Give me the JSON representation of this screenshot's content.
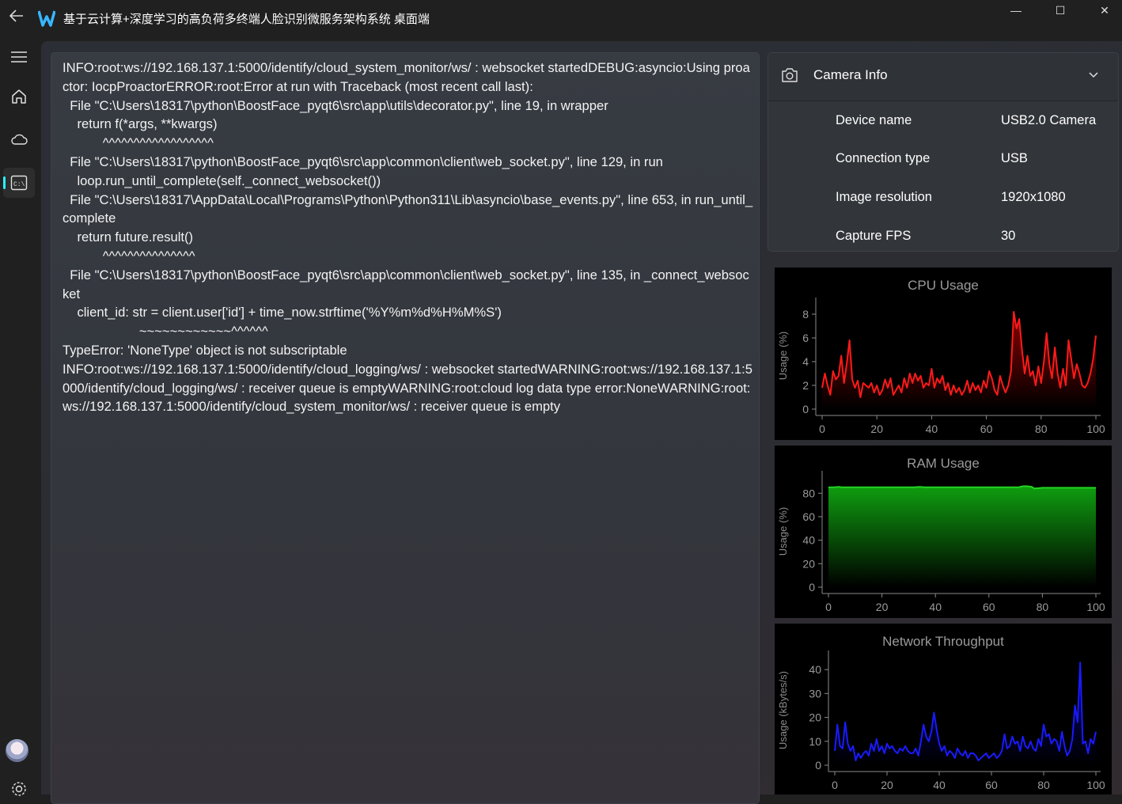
{
  "window": {
    "title": "基于云计算+深度学习的高负荷多终端人脸识别微服务架构系统 桌面端",
    "controls": {
      "minimize": "—",
      "maximize": "☐",
      "close": "✕"
    }
  },
  "sidebar": {
    "items": [
      {
        "name": "menu",
        "icon": "hamburger-icon"
      },
      {
        "name": "home",
        "icon": "home-icon"
      },
      {
        "name": "cloud",
        "icon": "cloud-icon"
      },
      {
        "name": "console",
        "icon": "terminal-icon",
        "active": true
      }
    ],
    "bottom": [
      {
        "name": "avatar"
      },
      {
        "name": "settings",
        "icon": "gear-icon"
      }
    ]
  },
  "log": {
    "text": "INFO:root:ws://192.168.137.1:5000/identify/cloud_system_monitor/ws/ : websocket startedDEBUG:asyncio:Using proactor: IocpProactorERROR:root:Error at run with Traceback (most recent call last):\n  File \"C:\\Users\\18317\\python\\BoostFace_pyqt6\\src\\app\\utils\\decorator.py\", line 19, in wrapper\n    return f(*args, **kwargs)\n           ^^^^^^^^^^^^^^^^^^\n  File \"C:\\Users\\18317\\python\\BoostFace_pyqt6\\src\\app\\common\\client\\web_socket.py\", line 129, in run\n    loop.run_until_complete(self._connect_websocket())\n  File \"C:\\Users\\18317\\AppData\\Local\\Programs\\Python\\Python311\\Lib\\asyncio\\base_events.py\", line 653, in run_until_complete\n    return future.result()\n           ^^^^^^^^^^^^^^^\n  File \"C:\\Users\\18317\\python\\BoostFace_pyqt6\\src\\app\\common\\client\\web_socket.py\", line 135, in _connect_websocket\n    client_id: str = client.user['id'] + time_now.strftime('%Y%m%d%H%M%S')\n                     ~~~~~~~~~~~~^^^^^^\nTypeError: 'NoneType' object is not subscriptable\nINFO:root:ws://192.168.137.1:5000/identify/cloud_logging/ws/ : websocket startedWARNING:root:ws://192.168.137.1:5000/identify/cloud_logging/ws/ : receiver queue is emptyWARNING:root:cloud log data type error:NoneWARNING:root:ws://192.168.137.1:5000/identify/cloud_system_monitor/ws/ : receiver queue is empty"
  },
  "camera": {
    "title": "Camera Info",
    "rows": [
      {
        "label": "Device name",
        "value": "USB2.0 Camera"
      },
      {
        "label": "Connection type",
        "value": "USB"
      },
      {
        "label": "Image resolution",
        "value": "1920x1080"
      },
      {
        "label": "Capture FPS",
        "value": "30"
      }
    ]
  },
  "chart_data": [
    {
      "type": "area",
      "title": "CPU Usage",
      "ylabel": "Usage (%)",
      "xlabel": "",
      "xlim": [
        0,
        100
      ],
      "ylim": [
        0,
        9
      ],
      "xticks": [
        0,
        20,
        40,
        60,
        80,
        100
      ],
      "yticks": [
        0,
        2,
        4,
        6,
        8
      ],
      "color": "#ff1a1a",
      "fill_top": "#8a0000",
      "grid": false,
      "values": [
        1.8,
        3.0,
        2.0,
        1.2,
        3.2,
        2.5,
        2.8,
        4.5,
        2.2,
        3.8,
        5.8,
        2.5,
        1.8,
        2.4,
        1.0,
        2.2,
        2.0,
        1.8,
        2.2,
        1.4,
        2.0,
        1.2,
        1.6,
        2.5,
        1.8,
        2.6,
        1.2,
        1.6,
        2.0,
        1.4,
        2.6,
        1.8,
        3.0,
        2.2,
        3.0,
        2.4,
        2.8,
        1.8,
        2.2,
        2.0,
        3.4,
        1.8,
        2.6,
        2.2,
        2.8,
        1.6,
        2.2,
        1.2,
        2.0,
        1.4,
        1.8,
        1.2,
        1.6,
        2.4,
        1.4,
        2.2,
        1.6,
        2.0,
        1.4,
        2.4,
        1.8,
        3.2,
        2.6,
        1.6,
        1.2,
        2.8,
        2.0,
        1.4,
        2.0,
        3.2,
        8.2,
        6.8,
        7.6,
        5.0,
        3.0,
        4.5,
        2.8,
        3.2,
        2.0,
        3.6,
        2.2,
        4.0,
        6.4,
        3.8,
        2.6,
        5.2,
        3.0,
        1.8,
        3.4,
        2.0,
        5.8,
        4.2,
        2.6,
        3.8,
        3.0,
        2.0,
        1.8,
        2.2,
        3.0,
        4.2,
        6.2
      ]
    },
    {
      "type": "area",
      "title": "RAM Usage",
      "ylabel": "Usage (%)",
      "xlabel": "",
      "xlim": [
        0,
        100
      ],
      "ylim": [
        0,
        95
      ],
      "xticks": [
        0,
        20,
        40,
        60,
        80,
        100
      ],
      "yticks": [
        0,
        20,
        40,
        60,
        80
      ],
      "color": "#22d422",
      "fill_top": "#0f9e0f",
      "grid": false,
      "values": [
        85,
        85,
        85,
        85.2,
        85.4,
        85,
        85,
        85,
        85,
        85,
        85,
        85,
        85,
        85,
        85,
        85,
        85,
        85,
        85,
        85,
        85,
        85,
        85,
        85,
        85,
        85,
        85,
        85,
        85,
        85,
        85,
        85,
        85,
        85.2,
        85.4,
        85.2,
        85,
        85,
        85,
        85,
        85,
        85,
        85,
        85,
        85,
        85,
        85,
        85,
        85,
        85,
        85,
        85,
        85,
        85,
        85,
        85,
        85,
        85,
        85,
        85,
        85,
        85,
        85,
        85,
        85,
        85,
        85,
        85,
        85,
        85,
        85,
        85,
        85.6,
        86,
        86,
        85.8,
        85.4,
        84,
        84.2,
        84.4,
        84.6,
        84.6,
        84.6,
        84.6,
        84.6,
        84.6,
        84.6,
        84.6,
        84.6,
        84.6,
        84.6,
        84.6,
        84.6,
        84.6,
        84.6,
        84.6,
        84.6,
        84.6,
        84.6,
        84.6,
        84.6
      ]
    },
    {
      "type": "area",
      "title": "Network Throughput",
      "ylabel": "Usage (kBytes/s)",
      "xlabel": "",
      "xlim": [
        0,
        100
      ],
      "ylim": [
        0,
        46
      ],
      "xticks": [
        0,
        20,
        40,
        60,
        80,
        100
      ],
      "yticks": [
        0,
        10,
        20,
        30,
        40
      ],
      "color": "#1a1aff",
      "fill_top": "#00007a",
      "grid": false,
      "values": [
        6,
        17,
        8,
        7,
        18,
        9,
        6,
        8,
        2,
        5,
        3,
        5,
        6,
        4,
        9,
        6,
        11,
        6,
        8,
        5,
        9,
        7,
        8,
        6,
        5,
        7,
        6,
        8,
        6,
        5,
        5,
        7,
        4,
        10,
        17,
        12,
        10,
        14,
        22,
        15,
        9,
        6,
        8,
        4,
        6,
        5,
        3,
        7,
        5,
        4,
        6,
        3,
        5,
        5,
        4,
        2,
        3,
        4,
        5,
        3,
        4,
        5,
        3,
        4,
        6,
        13,
        7,
        8,
        12,
        9,
        10,
        6,
        12,
        8,
        7,
        10,
        7,
        6,
        11,
        8,
        17,
        12,
        13,
        9,
        11,
        10,
        6,
        14,
        8,
        4,
        6,
        11,
        25,
        18,
        43,
        9,
        10,
        5,
        11,
        9,
        14
      ]
    }
  ]
}
